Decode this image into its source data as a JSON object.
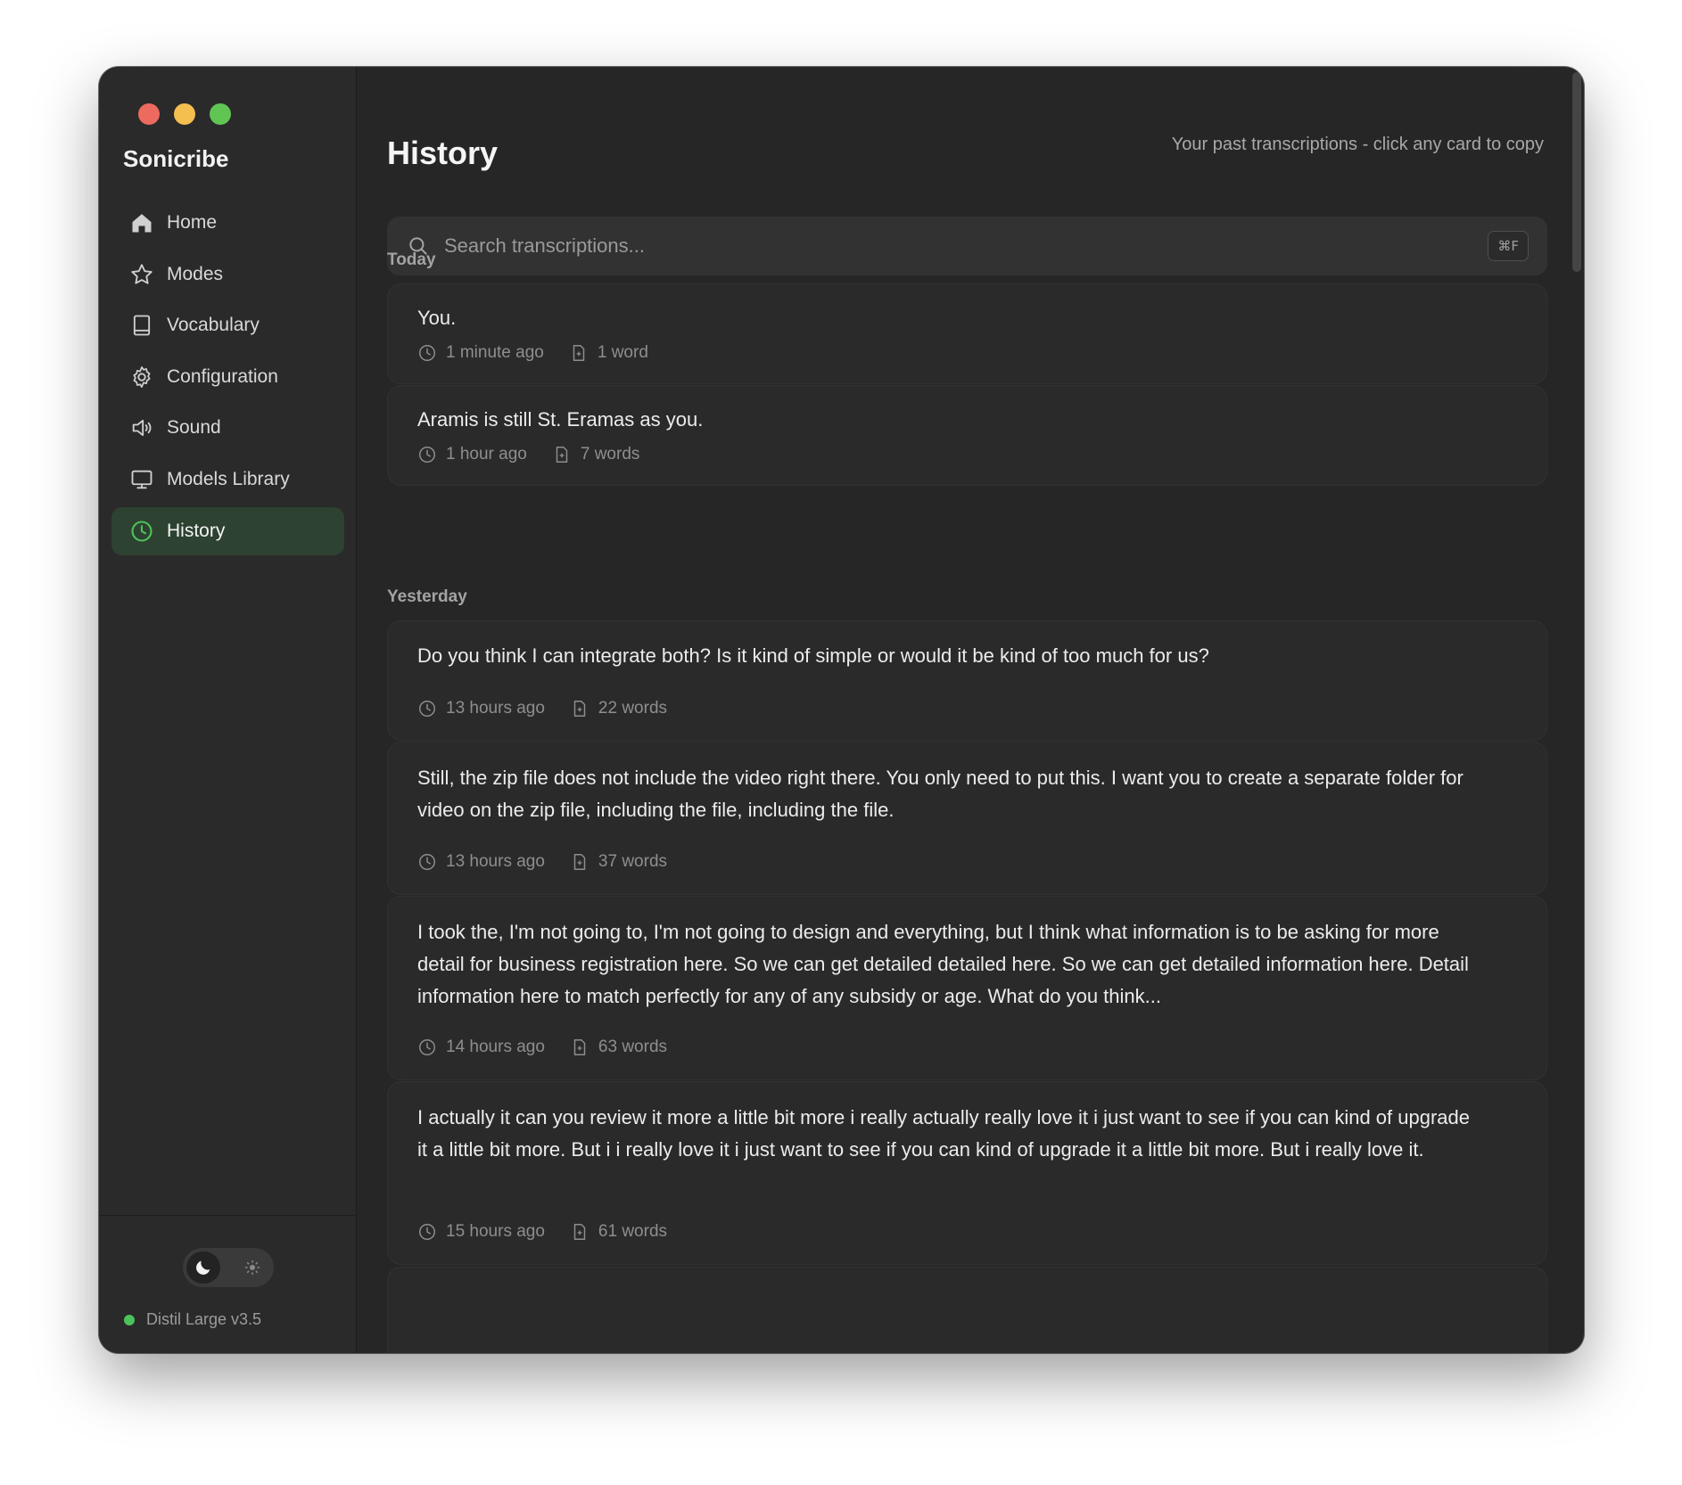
{
  "app": {
    "name": "Sonicribe",
    "colors": {
      "accent_green": "#4cc35a",
      "active_bg": "#2e4231",
      "window_bg": "#262626",
      "sidebar_bg": "#2a2a2a",
      "card_bg": "#2a2a2a"
    }
  },
  "sidebar": {
    "items": [
      {
        "label": "Home",
        "icon": "home-icon",
        "active": false
      },
      {
        "label": "Modes",
        "icon": "star-icon",
        "active": false
      },
      {
        "label": "Vocabulary",
        "icon": "book-icon",
        "active": false
      },
      {
        "label": "Configuration",
        "icon": "gear-icon",
        "active": false
      },
      {
        "label": "Sound",
        "icon": "speaker-icon",
        "active": false
      },
      {
        "label": "Models Library",
        "icon": "monitor-icon",
        "active": false
      },
      {
        "label": "History",
        "icon": "clock-icon",
        "active": true
      }
    ],
    "theme_toggle": {
      "selected": "dark",
      "icons": [
        "moon-icon",
        "sun-icon"
      ]
    },
    "model_status": {
      "label": "Distil Large v3.5",
      "status_color": "#4cc35a"
    }
  },
  "header": {
    "title": "History",
    "subtitle": "Your past transcriptions - click any card to copy"
  },
  "search": {
    "placeholder": "Search transcriptions...",
    "value": "",
    "shortcut": "⌘F"
  },
  "sections": [
    {
      "label": "Today",
      "entries": [
        {
          "text": "You.",
          "time": "1 minute ago",
          "words": "1 word"
        },
        {
          "text": "Aramis is still St. Eramas as you.",
          "time": "1 hour ago",
          "words": "7 words"
        }
      ]
    },
    {
      "label": "Yesterday",
      "entries": [
        {
          "text": "Do you think I can integrate both? Is it kind of simple or would it be kind of too much for us?",
          "time": "13 hours ago",
          "words": "22 words"
        },
        {
          "text": "Still, the zip file does not include the video right there. You only need to put this. I want you to create a separate folder for video on the zip file, including the file, including the file.",
          "time": "13 hours ago",
          "words": "37 words"
        },
        {
          "text": "I took the, I'm not going to, I'm not going to design and everything, but I think what information is to be asking for more detail for business registration here. So we can get detailed detailed here. So we can get detailed information here. Detail information here to match perfectly for any of any subsidy or age. What do you think...",
          "time": "14 hours ago",
          "words": "63 words"
        },
        {
          "text": "I actually it can you review it more a little bit more i really actually really love it i just want to see if you can kind of upgrade it a little bit more. But i i really love it i just want to see if you can kind of upgrade it a little bit more. But i really love it.",
          "time": "15 hours ago",
          "words": "61 words"
        }
      ]
    }
  ]
}
